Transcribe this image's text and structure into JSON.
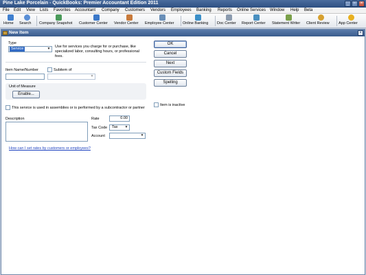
{
  "app": {
    "title": "Pine Lake Porcelain  - QuickBooks: Premier Accountant Edition 2011",
    "window_buttons": [
      "_",
      "▫",
      "×"
    ]
  },
  "menu": [
    "File",
    "Edit",
    "View",
    "Lists",
    "Favorites",
    "Accountant",
    "Company",
    "Customers",
    "Vendors",
    "Employees",
    "Banking",
    "Reports",
    "Online Services",
    "Window",
    "Help",
    "Beta"
  ],
  "toolbar": [
    {
      "label": "Home",
      "icon": "home-icon",
      "color": "#3f7fcf"
    },
    {
      "label": "Search",
      "icon": "search-icon",
      "color": "#5a8fd6"
    },
    {
      "label": "Company Snapshot",
      "icon": "snapshot-icon",
      "color": "#4a9a5a"
    },
    {
      "label": "Customer Center",
      "icon": "customer-icon",
      "color": "#3b78c8"
    },
    {
      "label": "Vendor Center",
      "icon": "vendor-icon",
      "color": "#c87a3b"
    },
    {
      "label": "Employee Center",
      "icon": "employee-icon",
      "color": "#6a8fb8"
    },
    {
      "label": "Online Banking",
      "icon": "bank-icon",
      "color": "#3b8fc8"
    },
    {
      "label": "Doc Center",
      "icon": "document-icon",
      "color": "#8a9aae"
    },
    {
      "label": "Report Center",
      "icon": "report-icon",
      "color": "#4a90c0"
    },
    {
      "label": "Statement Writer",
      "icon": "statement-icon",
      "color": "#7aa04a"
    },
    {
      "label": "Client Review",
      "icon": "review-icon",
      "color": "#d6a030"
    },
    {
      "label": "App Center",
      "icon": "app-center-icon",
      "color": "#e8b020"
    }
  ],
  "dialog": {
    "title": "New Item",
    "type_label": "Type",
    "type_value": "Service",
    "type_description": "Use for services you charge for or purchase, like specialized labor, consulting hours, or professional fees.",
    "item_name_label": "Item Name/Number",
    "item_name_value": "",
    "subitem_label": "Subitem of",
    "subitem_value": "",
    "unit_label": "Unit of Measure",
    "enable_label": "Enable...",
    "assemblies_label": "This service is used in assemblies or is performed by a subcontractor or partner",
    "description_label": "Description",
    "rate_label": "Rate",
    "rate_value": "0.00",
    "taxcode_label": "Tax Code",
    "taxcode_value": "Tax",
    "account_label": "Account",
    "account_value": "",
    "help_link": "How can I set rates by customers or employees?",
    "inactive_label": "Item is inactive",
    "buttons": {
      "ok": "OK",
      "cancel": "Cancel",
      "next": "Next",
      "custom_fields": "Custom Fields",
      "spelling": "Spelling"
    }
  }
}
